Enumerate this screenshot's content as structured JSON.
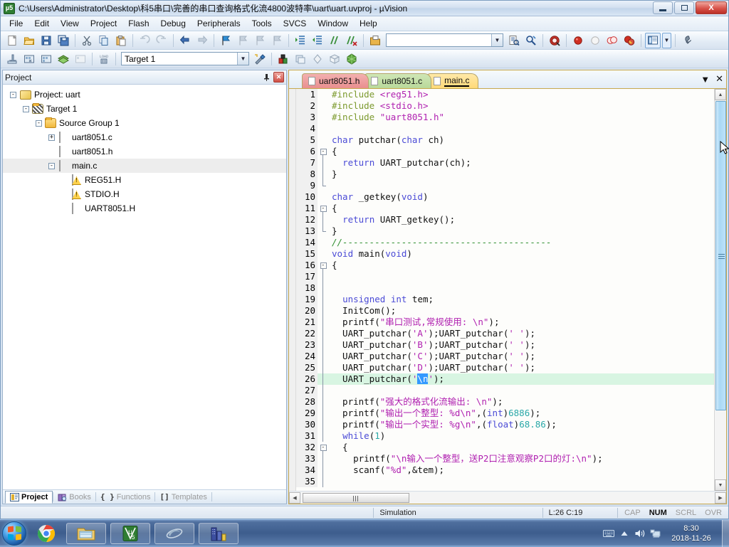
{
  "window": {
    "title": "C:\\Users\\Administrator\\Desktop\\科5串口\\完善的串口查询格式化流4800波特率\\uart\\uart.uvproj - µVision",
    "app_icon_label": "µ5",
    "minimize_label": "Minimize",
    "maximize_label": "Restore",
    "close_label": "X"
  },
  "menu": {
    "items": [
      "File",
      "Edit",
      "View",
      "Project",
      "Flash",
      "Debug",
      "Peripherals",
      "Tools",
      "SVCS",
      "Window",
      "Help"
    ]
  },
  "toolbar_main": {
    "find_box_value": "",
    "find_box_placeholder": "",
    "buttons": [
      "new-file-icon",
      "open-file-icon",
      "save-icon",
      "save-all-icon",
      "cut-icon",
      "copy-icon",
      "paste-icon",
      "undo-icon",
      "redo-icon",
      "navigate-back-icon",
      "navigate-forward-icon",
      "bookmark-toggle-icon",
      "bookmark-prev-icon",
      "bookmark-next-icon",
      "bookmark-clear-icon",
      "indent-icon",
      "outdent-icon",
      "comment-icon",
      "uncomment-icon",
      "open-include-icon",
      "find-in-files-icon",
      "find-icon",
      "debug-session-icon",
      "insert-breakpoint-icon",
      "disable-breakpoint-icon",
      "kill-all-breakpoints-icon",
      "disable-all-breakpoints-icon",
      "window-layout-icon",
      "layout-dropdown-icon",
      "configuration-wizard-icon"
    ]
  },
  "toolbar_build": {
    "target_value": "Target 1",
    "buttons": [
      "translate-icon",
      "build-icon",
      "rebuild-icon",
      "batch-build-icon",
      "stop-build-icon",
      "download-icon",
      "target-options-icon",
      "manage-components-icon",
      "manage-multi-project-icon",
      "pack-installer-icon",
      "manage-run-time-icon",
      "pack-icon"
    ]
  },
  "project_panel": {
    "title": "Project",
    "pin_label": "Auto Hide",
    "close_label": "Close",
    "tree": [
      {
        "label": "Project: uart",
        "depth": 0,
        "expander": "-",
        "icon": "project-icon",
        "selected": false
      },
      {
        "label": "Target 1",
        "depth": 1,
        "expander": "-",
        "icon": "target-icon",
        "selected": false
      },
      {
        "label": "Source Group 1",
        "depth": 2,
        "expander": "-",
        "icon": "folder-icon",
        "selected": false
      },
      {
        "label": "uart8051.c",
        "depth": 3,
        "expander": "+",
        "icon": "c-file-icon",
        "selected": false
      },
      {
        "label": "uart8051.h",
        "depth": 3,
        "expander": "",
        "icon": "h-file-icon",
        "selected": false
      },
      {
        "label": "main.c",
        "depth": 3,
        "expander": "-",
        "icon": "c-file-icon",
        "selected": true
      },
      {
        "label": "REG51.H",
        "depth": 4,
        "expander": "",
        "icon": "header-warn-icon",
        "selected": false
      },
      {
        "label": "STDIO.H",
        "depth": 4,
        "expander": "",
        "icon": "header-warn-icon",
        "selected": false
      },
      {
        "label": "UART8051.H",
        "depth": 4,
        "expander": "",
        "icon": "h-file-icon",
        "selected": false
      }
    ],
    "tabs": [
      {
        "label": "Project",
        "icon": "project-tab-icon",
        "active": true
      },
      {
        "label": "Books",
        "icon": "books-tab-icon",
        "active": false
      },
      {
        "label": "Functions",
        "icon": "functions-tab-icon",
        "active": false
      },
      {
        "label": "Templates",
        "icon": "templates-tab-icon",
        "active": false
      }
    ]
  },
  "editor": {
    "tabs": [
      {
        "label": "uart8051.h",
        "color": "red",
        "active": false
      },
      {
        "label": "uart8051.c",
        "color": "green",
        "active": false
      },
      {
        "label": "main.c",
        "color": "yellow",
        "active": true
      }
    ],
    "tab_list_label": "▼",
    "tab_close_label": "✕",
    "current_line": 26,
    "lines": [
      {
        "n": 1,
        "fold": "",
        "tokens": [
          {
            "t": "#include ",
            "c": "pp"
          },
          {
            "t": "<reg51.h>",
            "c": "str"
          }
        ]
      },
      {
        "n": 2,
        "fold": "",
        "tokens": [
          {
            "t": "#include ",
            "c": "pp"
          },
          {
            "t": "<stdio.h>",
            "c": "str"
          }
        ]
      },
      {
        "n": 3,
        "fold": "",
        "tokens": [
          {
            "t": "#include ",
            "c": "pp"
          },
          {
            "t": "\"uart8051.h\"",
            "c": "str"
          }
        ]
      },
      {
        "n": 4,
        "fold": "",
        "tokens": []
      },
      {
        "n": 5,
        "fold": "",
        "tokens": [
          {
            "t": "char",
            "c": "k"
          },
          {
            "t": " putchar(",
            "c": "pl"
          },
          {
            "t": "char",
            "c": "k"
          },
          {
            "t": " ch)",
            "c": "pl"
          }
        ]
      },
      {
        "n": 6,
        "fold": "open",
        "tokens": [
          {
            "t": "{",
            "c": "pl"
          }
        ]
      },
      {
        "n": 7,
        "fold": "mid",
        "tokens": [
          {
            "t": "  ",
            "c": "pl"
          },
          {
            "t": "return",
            "c": "k"
          },
          {
            "t": " UART_putchar(ch);",
            "c": "pl"
          }
        ]
      },
      {
        "n": 8,
        "fold": "mid",
        "tokens": [
          {
            "t": "}",
            "c": "pl"
          }
        ]
      },
      {
        "n": 9,
        "fold": "end",
        "tokens": []
      },
      {
        "n": 10,
        "fold": "",
        "tokens": [
          {
            "t": "char",
            "c": "k"
          },
          {
            "t": " _getkey(",
            "c": "pl"
          },
          {
            "t": "void",
            "c": "k"
          },
          {
            "t": ")",
            "c": "pl"
          }
        ]
      },
      {
        "n": 11,
        "fold": "open",
        "tokens": [
          {
            "t": "{",
            "c": "pl"
          }
        ]
      },
      {
        "n": 12,
        "fold": "mid",
        "tokens": [
          {
            "t": "  ",
            "c": "pl"
          },
          {
            "t": "return",
            "c": "k"
          },
          {
            "t": " UART_getkey();",
            "c": "pl"
          }
        ]
      },
      {
        "n": 13,
        "fold": "end2",
        "tokens": [
          {
            "t": "}",
            "c": "pl"
          }
        ]
      },
      {
        "n": 14,
        "fold": "",
        "tokens": [
          {
            "t": "//---------------------------------------",
            "c": "cmt"
          }
        ]
      },
      {
        "n": 15,
        "fold": "",
        "tokens": [
          {
            "t": "void",
            "c": "k"
          },
          {
            "t": " main(",
            "c": "pl"
          },
          {
            "t": "void",
            "c": "k"
          },
          {
            "t": ")",
            "c": "pl"
          }
        ]
      },
      {
        "n": 16,
        "fold": "open",
        "tokens": [
          {
            "t": "{",
            "c": "pl"
          }
        ]
      },
      {
        "n": 17,
        "fold": "mid",
        "tokens": []
      },
      {
        "n": 18,
        "fold": "mid",
        "tokens": []
      },
      {
        "n": 19,
        "fold": "mid",
        "tokens": [
          {
            "t": "  ",
            "c": "pl"
          },
          {
            "t": "unsigned",
            "c": "k"
          },
          {
            "t": " ",
            "c": "pl"
          },
          {
            "t": "int",
            "c": "k"
          },
          {
            "t": " tem;",
            "c": "pl"
          }
        ]
      },
      {
        "n": 20,
        "fold": "mid",
        "tokens": [
          {
            "t": "  InitCom();",
            "c": "pl"
          }
        ]
      },
      {
        "n": 21,
        "fold": "mid",
        "tokens": [
          {
            "t": "  printf(",
            "c": "pl"
          },
          {
            "t": "\"串口测试,常规使用: \\n\"",
            "c": "str"
          },
          {
            "t": ");",
            "c": "pl"
          }
        ]
      },
      {
        "n": 22,
        "fold": "mid",
        "tokens": [
          {
            "t": "  UART_putchar(",
            "c": "pl"
          },
          {
            "t": "'A'",
            "c": "str"
          },
          {
            "t": ");UART_putchar(",
            "c": "pl"
          },
          {
            "t": "' '",
            "c": "str"
          },
          {
            "t": ");",
            "c": "pl"
          }
        ]
      },
      {
        "n": 23,
        "fold": "mid",
        "tokens": [
          {
            "t": "  UART_putchar(",
            "c": "pl"
          },
          {
            "t": "'B'",
            "c": "str"
          },
          {
            "t": ");UART_putchar(",
            "c": "pl"
          },
          {
            "t": "' '",
            "c": "str"
          },
          {
            "t": ");",
            "c": "pl"
          }
        ]
      },
      {
        "n": 24,
        "fold": "mid",
        "tokens": [
          {
            "t": "  UART_putchar(",
            "c": "pl"
          },
          {
            "t": "'C'",
            "c": "str"
          },
          {
            "t": ");UART_putchar(",
            "c": "pl"
          },
          {
            "t": "' '",
            "c": "str"
          },
          {
            "t": ");",
            "c": "pl"
          }
        ]
      },
      {
        "n": 25,
        "fold": "mid",
        "tokens": [
          {
            "t": "  UART_putchar(",
            "c": "pl"
          },
          {
            "t": "'D'",
            "c": "str"
          },
          {
            "t": ");UART_putchar(",
            "c": "pl"
          },
          {
            "t": "' '",
            "c": "str"
          },
          {
            "t": ");",
            "c": "pl"
          }
        ]
      },
      {
        "n": 26,
        "fold": "mid",
        "hl": true,
        "tokens": [
          {
            "t": "  UART_putchar(",
            "c": "pl"
          },
          {
            "t": "'",
            "c": "str"
          },
          {
            "t": "\\n",
            "c": "sel"
          },
          {
            "t": "'",
            "c": "str"
          },
          {
            "t": ");",
            "c": "pl"
          }
        ]
      },
      {
        "n": 27,
        "fold": "mid",
        "tokens": []
      },
      {
        "n": 28,
        "fold": "mid",
        "tokens": [
          {
            "t": "  printf(",
            "c": "pl"
          },
          {
            "t": "\"强大的格式化流输出: \\n\"",
            "c": "str"
          },
          {
            "t": ");",
            "c": "pl"
          }
        ]
      },
      {
        "n": 29,
        "fold": "mid",
        "tokens": [
          {
            "t": "  printf(",
            "c": "pl"
          },
          {
            "t": "\"输出一个整型: %d\\n\"",
            "c": "str"
          },
          {
            "t": ",(",
            "c": "pl"
          },
          {
            "t": "int",
            "c": "k"
          },
          {
            "t": ")",
            "c": "pl"
          },
          {
            "t": "6886",
            "c": "num"
          },
          {
            "t": ");",
            "c": "pl"
          }
        ]
      },
      {
        "n": 30,
        "fold": "mid",
        "tokens": [
          {
            "t": "  printf(",
            "c": "pl"
          },
          {
            "t": "\"输出一个实型: %g\\n\"",
            "c": "str"
          },
          {
            "t": ",(",
            "c": "pl"
          },
          {
            "t": "float",
            "c": "k"
          },
          {
            "t": ")",
            "c": "pl"
          },
          {
            "t": "68.86",
            "c": "num"
          },
          {
            "t": ");",
            "c": "pl"
          }
        ]
      },
      {
        "n": 31,
        "fold": "mid",
        "tokens": [
          {
            "t": "  ",
            "c": "pl"
          },
          {
            "t": "while",
            "c": "k"
          },
          {
            "t": "(",
            "c": "pl"
          },
          {
            "t": "1",
            "c": "num"
          },
          {
            "t": ")",
            "c": "pl"
          }
        ]
      },
      {
        "n": 32,
        "fold": "open2",
        "tokens": [
          {
            "t": "  {",
            "c": "pl"
          }
        ]
      },
      {
        "n": 33,
        "fold": "mid",
        "tokens": [
          {
            "t": "    printf(",
            "c": "pl"
          },
          {
            "t": "\"\\n输入一个整型，送P2口注意观察P2口的灯:\\n\"",
            "c": "str"
          },
          {
            "t": ");",
            "c": "pl"
          }
        ]
      },
      {
        "n": 34,
        "fold": "mid",
        "tokens": [
          {
            "t": "    scanf(",
            "c": "pl"
          },
          {
            "t": "\"%d\"",
            "c": "str"
          },
          {
            "t": ",&tem);",
            "c": "pl"
          }
        ]
      },
      {
        "n": 35,
        "fold": "mid",
        "tokens": []
      }
    ]
  },
  "statusbar": {
    "mode": "Simulation",
    "cursor_pos": "L:26 C:19",
    "flags": [
      {
        "label": "CAP",
        "on": false
      },
      {
        "label": "NUM",
        "on": true
      },
      {
        "label": "SCRL",
        "on": false
      },
      {
        "label": "OVR",
        "on": false
      }
    ]
  },
  "taskbar": {
    "start_label": "Start",
    "items": [
      {
        "name": "chrome-taskbar-icon",
        "pinned_no_frame": true
      },
      {
        "name": "file-explorer-taskbar-icon",
        "pinned_no_frame": false
      },
      {
        "name": "uvision-taskbar-icon",
        "pinned_no_frame": false
      },
      {
        "name": "ie-taskbar-icon",
        "pinned_no_frame": false
      },
      {
        "name": "city-app-taskbar-icon",
        "pinned_no_frame": false
      }
    ],
    "tray": [
      "keyboard-layout-icon",
      "show-hidden-icons-icon",
      "volume-icon",
      "network-icon"
    ],
    "clock_time": "8:30",
    "clock_date": "2018-11-26"
  }
}
